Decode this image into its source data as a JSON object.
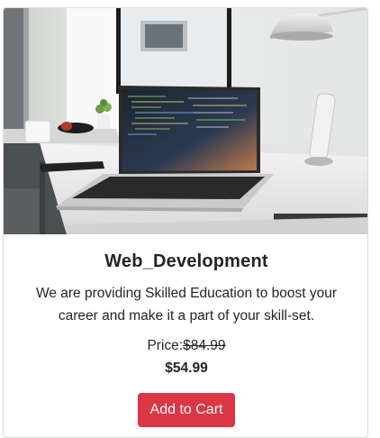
{
  "card": {
    "title": "Web_Development",
    "description": "We are providing Skilled Education to boost your career and make it a part of your skill-set.",
    "price_label": "Price:",
    "old_price": "$84.99",
    "new_price": "$54.99",
    "button_label": "Add to Cart"
  },
  "colors": {
    "button": "#dc3545",
    "border": "#d9d9d9"
  },
  "image": {
    "subject": "laptop-desk-photo"
  }
}
